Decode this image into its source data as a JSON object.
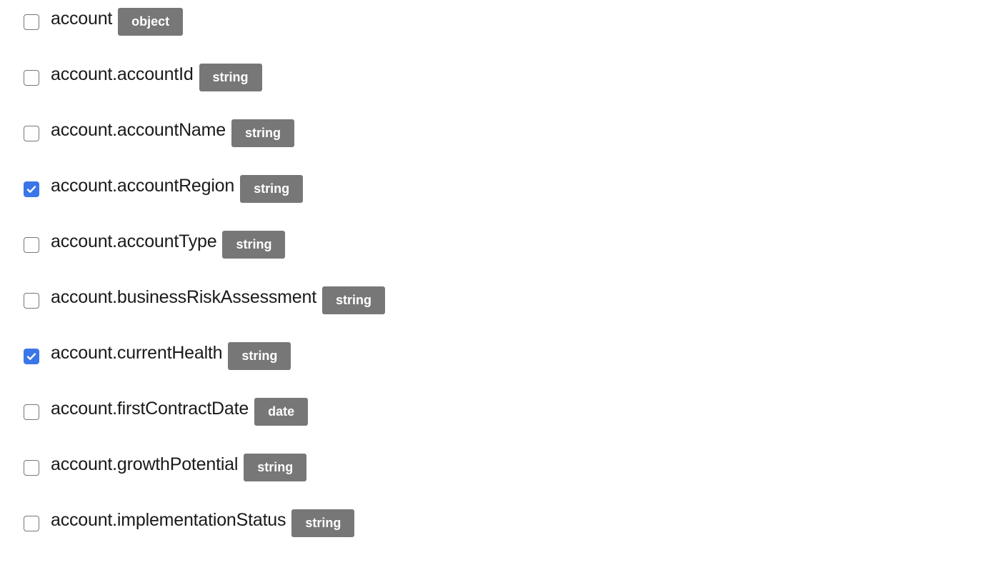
{
  "colors": {
    "checked": "#3b76e8",
    "badge_bg": "#777777",
    "badge_text": "#ffffff"
  },
  "fields": [
    {
      "name": "account",
      "type": "object",
      "checked": false
    },
    {
      "name": "account.accountId",
      "type": "string",
      "checked": false
    },
    {
      "name": "account.accountName",
      "type": "string",
      "checked": false
    },
    {
      "name": "account.accountRegion",
      "type": "string",
      "checked": true
    },
    {
      "name": "account.accountType",
      "type": "string",
      "checked": false
    },
    {
      "name": "account.businessRiskAssessment",
      "type": "string",
      "checked": false
    },
    {
      "name": "account.currentHealth",
      "type": "string",
      "checked": true
    },
    {
      "name": "account.firstContractDate",
      "type": "date",
      "checked": false
    },
    {
      "name": "account.growthPotential",
      "type": "string",
      "checked": false
    },
    {
      "name": "account.implementationStatus",
      "type": "string",
      "checked": false
    }
  ]
}
